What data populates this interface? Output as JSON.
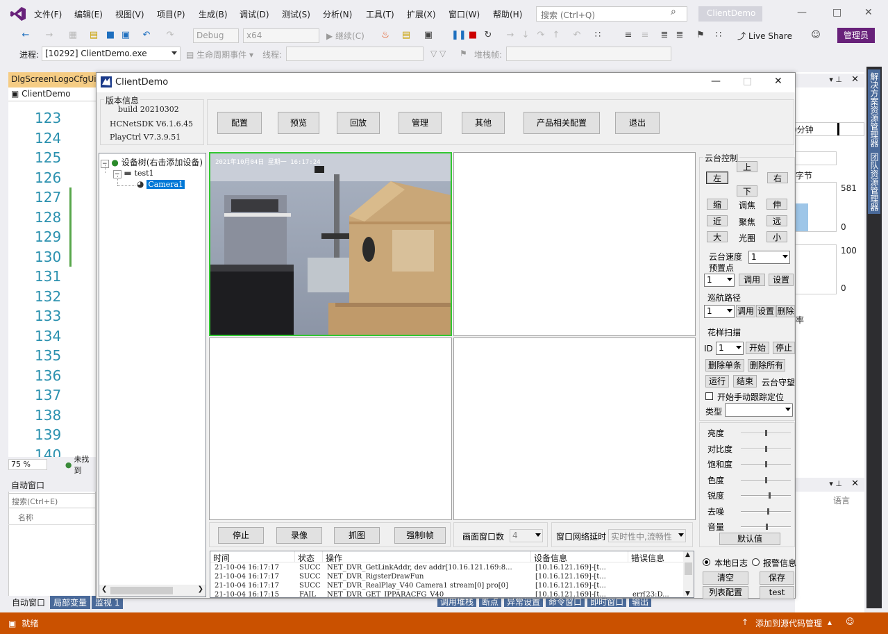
{
  "vs": {
    "menu": [
      "文件(F)",
      "编辑(E)",
      "视图(V)",
      "项目(P)",
      "生成(B)",
      "调试(D)",
      "测试(S)",
      "分析(N)",
      "工具(T)",
      "扩展(X)",
      "窗口(W)",
      "帮助(H)"
    ],
    "search_placeholder": "搜索 (Ctrl+Q)",
    "app_name": "ClientDemo",
    "config_debug": "Debug",
    "platform": "x64",
    "continue_label": "继续(C)",
    "live_share": "Live Share",
    "admin": "管理员",
    "process_label": "进程:",
    "process_value": "[10292] ClientDemo.exe",
    "lifecycle_label": "生命周期事件",
    "thread_label": "线程:",
    "stackframe_label": "堆栈帧:",
    "editor_tab": "DlgScreenLogoCfgUi",
    "editor_nav": "ClientDemo",
    "line_numbers": [
      "123",
      "124",
      "125",
      "126",
      "127",
      "128",
      "129",
      "130",
      "131",
      "132",
      "133",
      "134",
      "135",
      "136",
      "137",
      "138",
      "139",
      "140"
    ],
    "zoom": "75 %",
    "editor_issue": "未找到",
    "auto_window_title": "自动窗口",
    "auto_search": "搜索(Ctrl+E)",
    "auto_col_name": "名称",
    "bottom_tabs": [
      "自动窗口",
      "局部变量",
      "监视 1"
    ],
    "bottom_tabs_right": [
      "调用堆栈",
      "断点",
      "异常设置",
      "命令窗口",
      "即时窗口",
      "输出"
    ],
    "right_vtabs": [
      "解决方案资源管理器",
      "团队资源管理器"
    ],
    "right_panel": {
      "minutes": "0分钟",
      "bytes": "字节",
      "v581": "581",
      "v0a": "0",
      "v100": "100",
      "v0b": "0",
      "rate": "率",
      "lang": "语言"
    },
    "status_ready": "就绪",
    "status_add_source": "添加到源代码管理"
  },
  "app": {
    "title": "ClientDemo",
    "version": {
      "group": "版本信息",
      "build": "build 20210302",
      "sdk": "HCNetSDK V6.1.6.45",
      "playctrl": "PlayCtrl V7.3.9.51"
    },
    "top_buttons": [
      "配置",
      "预览",
      "回放",
      "管理",
      "其他",
      "产品相关配置",
      "退出"
    ],
    "tree": {
      "root": "设备树(右击添加设备)",
      "device": "test1",
      "camera": "Camera1"
    },
    "osd": "2021年10月04日 星期一 16:17:24",
    "ptz": {
      "group": "云台控制",
      "up": "上",
      "left": "左",
      "right": "右",
      "down": "下",
      "zoom_in": "缩",
      "zoom_label": "调焦",
      "zoom_out": "伸",
      "near": "近",
      "focus_label": "聚焦",
      "far": "远",
      "big": "大",
      "iris_label": "光圈",
      "small": "小",
      "speed_label": "云台速度",
      "speed_value": "1",
      "preset_label": "预置点",
      "preset_value": "1",
      "preset_call": "调用",
      "preset_set": "设置",
      "cruise_label": "巡航路径",
      "cruise_value": "1",
      "cruise_call": "调用",
      "cruise_set": "设置",
      "cruise_del": "删除",
      "pattern_label": "花样扫描",
      "pattern_id_label": "ID",
      "pattern_id": "1",
      "pattern_start": "开始",
      "pattern_stop": "停止",
      "pattern_del_one": "删除单条",
      "pattern_del_all": "删除所有",
      "run": "运行",
      "end": "结束",
      "guard": "云台守望",
      "track_label": "开始手动跟踪定位",
      "type_label": "类型"
    },
    "image": {
      "brightness": "亮度",
      "contrast": "对比度",
      "saturation": "饱和度",
      "hue": "色度",
      "sharpness": "锐度",
      "denoise": "去噪",
      "volume": "音量",
      "default": "默认值",
      "levels": [
        0.5,
        0.5,
        0.5,
        0.5,
        0.58,
        0.55,
        0.52
      ]
    },
    "bottom_buttons": [
      "停止",
      "录像",
      "抓图",
      "强制I帧"
    ],
    "window_count_label": "画面窗口数",
    "window_count_value": "4",
    "latency_label": "窗口网络延时",
    "latency_value": "实时性中,流畅性",
    "log": {
      "headers": [
        "时间",
        "状态",
        "操作",
        "设备信息",
        "错误信息"
      ],
      "rows": [
        [
          "21-10-04 16:17:17",
          "SUCC",
          "NET_DVR_GetLinkAddr, dev addr[10.16.121.169:8...",
          "[10.16.121.169]-[t...",
          ""
        ],
        [
          "21-10-04 16:17:17",
          "SUCC",
          "NET_DVR_RigsterDrawFun",
          "[10.16.121.169]-[t...",
          ""
        ],
        [
          "21-10-04 16:17:17",
          "SUCC",
          "NET_DVR_RealPlay_V40 Camera1 stream[0] pro[0]",
          "[10.16.121.169]-[t...",
          ""
        ],
        [
          "21-10-04 16:17:15",
          "FAIL",
          "NET_DVR_GET_IPPARACFG_V40",
          "[10.16.121.169]-[t...",
          "err[23:D..."
        ]
      ]
    },
    "log_local": "本地日志",
    "log_alarm": "报警信息",
    "clear": "清空",
    "save": "保存",
    "list_config": "列表配置",
    "test": "test"
  }
}
